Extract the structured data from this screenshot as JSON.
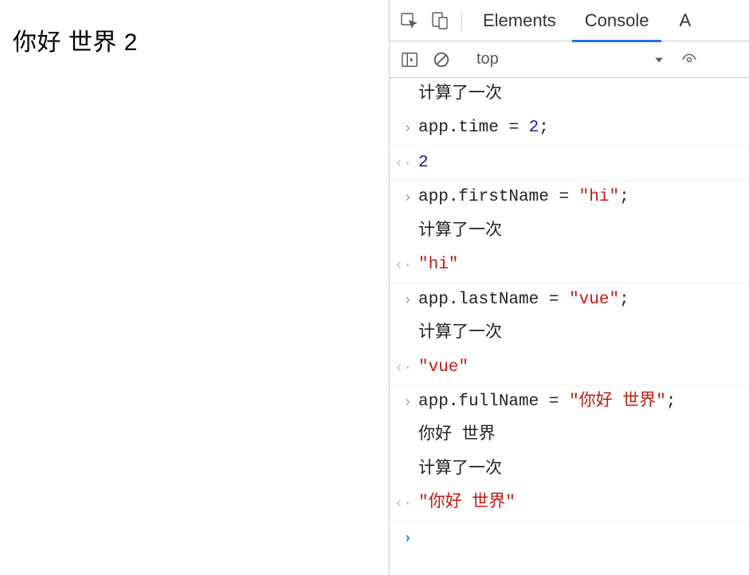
{
  "page": {
    "main_text": "你好 世界 2"
  },
  "devtools": {
    "tabs": {
      "elements": "Elements",
      "console": "Console",
      "partial": "A"
    },
    "subbar": {
      "context": "top"
    },
    "console": [
      {
        "kind": "log",
        "text": "计算了一次"
      },
      {
        "kind": "input",
        "tokens": [
          {
            "t": "obj",
            "v": "app"
          },
          {
            "t": "punc",
            "v": "."
          },
          {
            "t": "prop",
            "v": "time"
          },
          {
            "t": "op",
            "v": " = "
          },
          {
            "t": "num",
            "v": "2"
          },
          {
            "t": "punc",
            "v": ";"
          }
        ]
      },
      {
        "kind": "result",
        "tokens": [
          {
            "t": "num",
            "v": "2"
          }
        ]
      },
      {
        "kind": "input",
        "tokens": [
          {
            "t": "obj",
            "v": "app"
          },
          {
            "t": "punc",
            "v": "."
          },
          {
            "t": "prop",
            "v": "firstName"
          },
          {
            "t": "op",
            "v": " = "
          },
          {
            "t": "str",
            "v": "\"hi\""
          },
          {
            "t": "punc",
            "v": ";"
          }
        ]
      },
      {
        "kind": "log",
        "text": "计算了一次"
      },
      {
        "kind": "result",
        "tokens": [
          {
            "t": "str",
            "v": "\"hi\""
          }
        ]
      },
      {
        "kind": "input",
        "tokens": [
          {
            "t": "obj",
            "v": "app"
          },
          {
            "t": "punc",
            "v": "."
          },
          {
            "t": "prop",
            "v": "lastName"
          },
          {
            "t": "op",
            "v": " = "
          },
          {
            "t": "str",
            "v": "\"vue\""
          },
          {
            "t": "punc",
            "v": ";"
          }
        ]
      },
      {
        "kind": "log",
        "text": "计算了一次"
      },
      {
        "kind": "result",
        "tokens": [
          {
            "t": "str",
            "v": "\"vue\""
          }
        ]
      },
      {
        "kind": "input",
        "tokens": [
          {
            "t": "obj",
            "v": "app"
          },
          {
            "t": "punc",
            "v": "."
          },
          {
            "t": "prop",
            "v": "fullName"
          },
          {
            "t": "op",
            "v": " = "
          },
          {
            "t": "str",
            "v": "\"你好 世界\""
          },
          {
            "t": "punc",
            "v": ";"
          }
        ]
      },
      {
        "kind": "log",
        "text": "你好 世界"
      },
      {
        "kind": "log",
        "text": "计算了一次"
      },
      {
        "kind": "result",
        "tokens": [
          {
            "t": "str",
            "v": "\"你好 世界\""
          }
        ]
      },
      {
        "kind": "prompt"
      }
    ]
  }
}
